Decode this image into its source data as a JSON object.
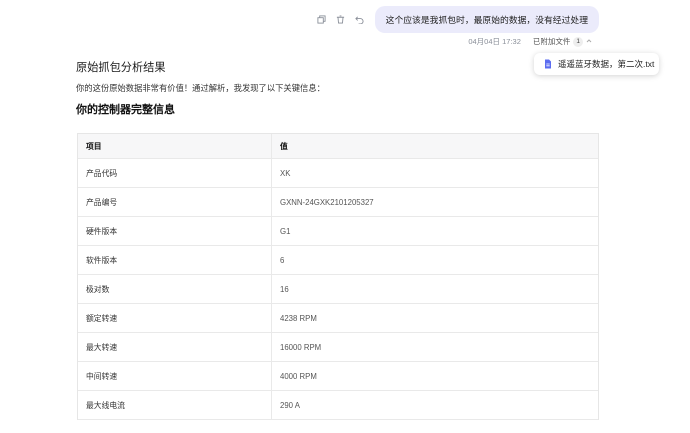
{
  "user_message": {
    "text": "这个应该是我抓包时，最原始的数据，没有经过处理",
    "timestamp": "04月04日 17:32",
    "attachments_label": "已附加文件",
    "attachments_count": "1",
    "actions": [
      "copy-icon",
      "delete-icon",
      "undo-icon"
    ]
  },
  "attachment_popup": {
    "file_name": "遥遥蓝牙数据，第二次.txt"
  },
  "assistant": {
    "heading": "原始抓包分析结果",
    "intro": "你的这份原始数据非常有价值！通过解析，我发现了以下关键信息：",
    "section_title": "你的控制器完整信息",
    "table": {
      "headers": [
        "项目",
        "值"
      ],
      "rows": [
        {
          "key": "产品代码",
          "value": "XK"
        },
        {
          "key": "产品编号",
          "value": "GXNN-24GXK2101205327"
        },
        {
          "key": "硬件版本",
          "value": "G1"
        },
        {
          "key": "软件版本",
          "value": "6"
        },
        {
          "key": "极对数",
          "value": "16"
        },
        {
          "key": "额定转速",
          "value": "4238 RPM"
        },
        {
          "key": "最大转速",
          "value": "16000 RPM"
        },
        {
          "key": "中间转速",
          "value": "4000 RPM"
        },
        {
          "key": "最大线电流",
          "value": "290 A"
        }
      ]
    }
  }
}
